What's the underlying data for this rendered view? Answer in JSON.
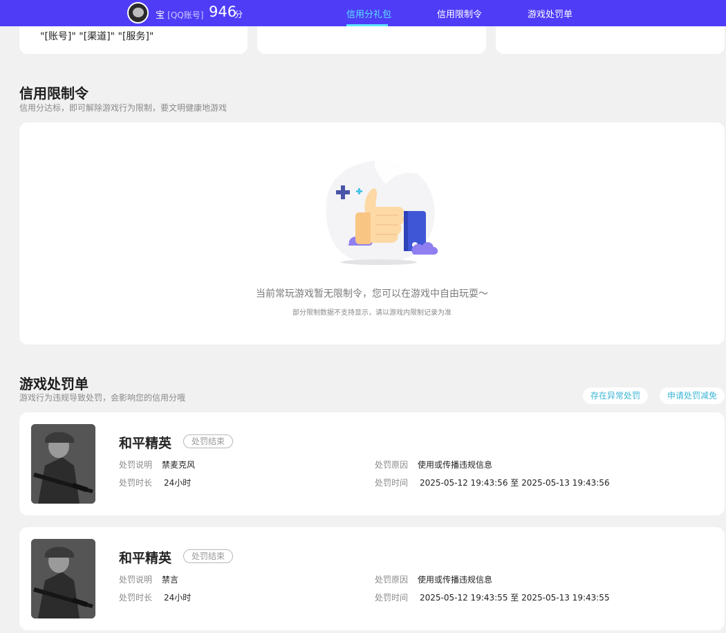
{
  "topbar": {
    "user_name": "宝",
    "account_type": "[QQ账号]",
    "score": "946",
    "score_unit": "分",
    "tabs": [
      {
        "label": "信用分礼包",
        "active": true
      },
      {
        "label": "信用限制令",
        "active": false
      },
      {
        "label": "游戏处罚单",
        "active": false
      }
    ]
  },
  "top_cards": [
    {
      "text": "\"[账号]\" \"[渠道]\" \"[服务]\""
    },
    {
      "text": ""
    },
    {
      "text": ""
    }
  ],
  "restriction": {
    "title": "信用限制令",
    "subtitle": "信用分达标，即可解除游戏行为限制，要文明健康地游戏",
    "empty_message": "当前常玩游戏暂无限制令，您可以在游戏中自由玩耍～",
    "empty_note": "部分限制数据不支持显示，请以游戏内限制记录为准"
  },
  "penalty": {
    "title": "游戏处罚单",
    "subtitle": "游戏行为违规导致处罚，会影响您的信用分哦",
    "btn_abnormal": "存在异常处罚",
    "btn_apply": "申请处罚减免",
    "labels": {
      "desc": "处罚说明",
      "reason": "处罚原因",
      "duration": "处罚时长",
      "time": "处罚时间",
      "time_sep": "至"
    },
    "items": [
      {
        "game": "和平精英",
        "status": "处罚结束",
        "desc": "禁麦克风",
        "reason": "使用或传播违规信息",
        "duration": "24小时",
        "start": "2025-05-12 19:43:56",
        "end": "2025-05-13 19:43:56"
      },
      {
        "game": "和平精英",
        "status": "处罚结束",
        "desc": "禁言",
        "reason": "使用或传播违规信息",
        "duration": "24小时",
        "start": "2025-05-12 19:43:55",
        "end": "2025-05-13 19:43:55"
      }
    ]
  }
}
